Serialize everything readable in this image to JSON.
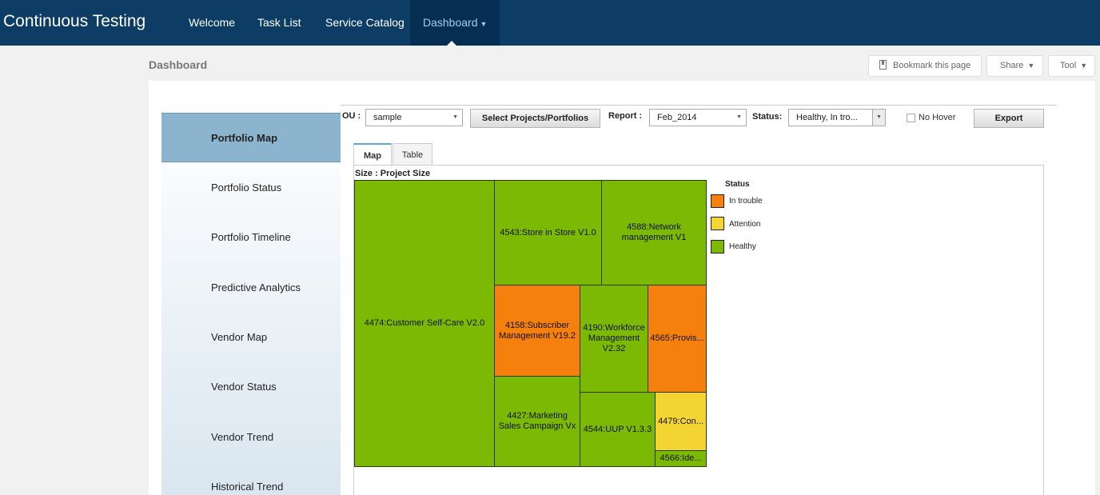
{
  "app": {
    "title": "Continuous Testing"
  },
  "nav": {
    "items": [
      {
        "label": "Welcome"
      },
      {
        "label": "Task List"
      },
      {
        "label": "Service Catalog"
      },
      {
        "label": "Dashboard"
      }
    ],
    "active": "Dashboard"
  },
  "page": {
    "title": "Dashboard"
  },
  "toolbar": {
    "bookmark_label": "Bookmark this page",
    "share_label": "Share",
    "tool_label": "Tool"
  },
  "sidebar": {
    "items": [
      {
        "label": "Portfolio Map",
        "active": true
      },
      {
        "label": "Portfolio Status"
      },
      {
        "label": "Portfolio Timeline"
      },
      {
        "label": "Predictive Analytics"
      },
      {
        "label": "Vendor Map"
      },
      {
        "label": "Vendor Status"
      },
      {
        "label": "Vendor Trend"
      },
      {
        "label": "Historical Trend"
      }
    ]
  },
  "filters": {
    "ou_label": "OU :",
    "ou_value": "sample",
    "select_projects_label": "Select Projects/Portfolios",
    "report_label": "Report :",
    "report_value": "Feb_2014",
    "status_label": "Status:",
    "status_value": "Healthy, In tro...",
    "no_hover_label": "No Hover",
    "no_hover_checked": false,
    "export_label": "Export"
  },
  "tabs": [
    {
      "label": "Map",
      "active": true
    },
    {
      "label": "Table"
    }
  ],
  "map": {
    "size_label": "Size : Project Size",
    "tiles": [
      {
        "label": "4474:Customer Self-Care V2.0",
        "status": "healthy"
      },
      {
        "label": "4543:Store in Store V1.0",
        "status": "healthy"
      },
      {
        "label": "4588:Network management V1",
        "status": "healthy"
      },
      {
        "label": "4158:Subscriber Management V19.2",
        "status": "in_trouble"
      },
      {
        "label": "4190:Workforce Management V2.32",
        "status": "healthy"
      },
      {
        "label": "4565:Provis...",
        "status": "in_trouble"
      },
      {
        "label": "4427:Marketing Sales Campaign Vx",
        "status": "healthy"
      },
      {
        "label": "4544:UUP V1.3.3",
        "status": "healthy"
      },
      {
        "label": "4479:Con...",
        "status": "attention"
      },
      {
        "label": "4566:Ide...",
        "status": "healthy"
      }
    ]
  },
  "legend": {
    "title": "Status",
    "items": [
      {
        "label": "In trouble",
        "color": "#f5800e"
      },
      {
        "label": "Attention",
        "color": "#f2d432"
      },
      {
        "label": "Healthy",
        "color": "#7cb904"
      }
    ]
  },
  "colors": {
    "nav_bg": "#0d3c64",
    "nav_active_bg": "#052e52",
    "in_trouble": "#f5800e",
    "attention": "#f2d432",
    "healthy": "#7cb904",
    "sidebar_active": "#8db4cf"
  }
}
